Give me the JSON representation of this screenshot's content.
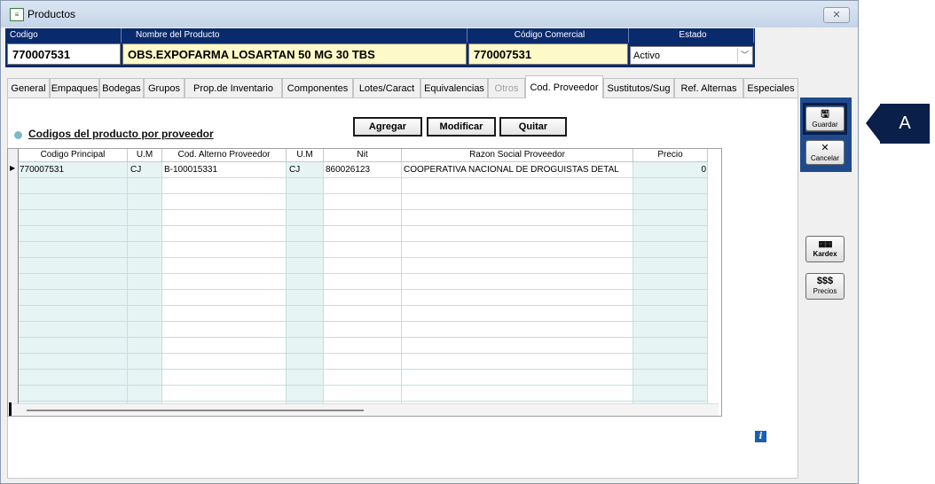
{
  "window": {
    "title": "Productos",
    "close": "✕"
  },
  "header": {
    "codigo_label": "Codigo",
    "nombre_label": "Nombre del Producto",
    "comercial_label": "Código Comercial",
    "estado_label": "Estado",
    "codigo_value": "770007531",
    "nombre_value": "OBS.EXPOFARMA LOSARTAN 50 MG 30 TBS",
    "comercial_value": "770007531",
    "estado_value": "Activo"
  },
  "tabs": [
    {
      "label": "General"
    },
    {
      "label": "Empaques"
    },
    {
      "label": "Bodegas"
    },
    {
      "label": "Grupos"
    },
    {
      "label": "Prop.de Inventario"
    },
    {
      "label": "Componentes"
    },
    {
      "label": "Lotes/Caract"
    },
    {
      "label": "Equivalencias"
    },
    {
      "label": "Otros"
    },
    {
      "label": "Cod. Proveedor"
    },
    {
      "label": "Sustitutos/Sug"
    },
    {
      "label": "Ref. Alternas"
    },
    {
      "label": "Especiales"
    }
  ],
  "section": {
    "title": "Codigos del producto por proveedor"
  },
  "actions": {
    "agregar": "Agregar",
    "modificar": "Modificar",
    "quitar": "Quitar"
  },
  "grid": {
    "columns": [
      "Codigo Principal",
      "U.M",
      "Cod. Alterno  Proveedor",
      "U.M",
      "Nit",
      "Razon Social Proveedor",
      "Precio"
    ],
    "rows": [
      [
        "770007531",
        "CJ",
        "B-100015331",
        "CJ",
        "860026123",
        "COOPERATIVA NACIONAL DE DROGUISTAS DETAL",
        "0"
      ]
    ]
  },
  "toolbar": {
    "guardar": "Guardar",
    "cancelar": "Cancelar",
    "kardex": "Kardex",
    "precios": "Precios",
    "precios_icon_text": "$$$"
  },
  "callout": {
    "label": "A"
  },
  "colors": {
    "header_bg": "#0a2a6e",
    "yellow_field": "#fdf9c8",
    "grid_tint": "#e6f4f4",
    "toolbar_bg": "#1f4b8e"
  }
}
